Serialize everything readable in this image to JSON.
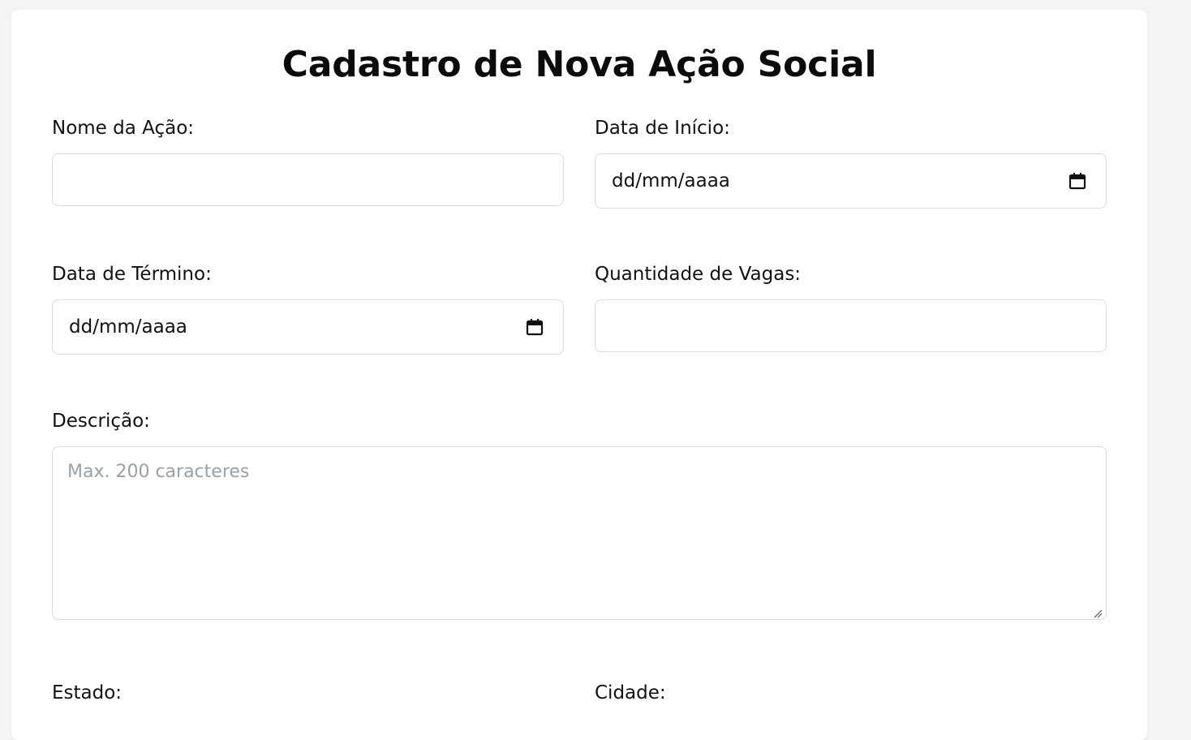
{
  "form": {
    "title": "Cadastro de Nova Ação Social",
    "fields": {
      "nome": {
        "label": "Nome da Ação:",
        "value": ""
      },
      "data_inicio": {
        "label": "Data de Início:",
        "value": "dd/mm/aaaa"
      },
      "data_termino": {
        "label": "Data de Término:",
        "value": "dd/mm/aaaa"
      },
      "vagas": {
        "label": "Quantidade de Vagas:",
        "value": ""
      },
      "descricao": {
        "label": "Descrição:",
        "placeholder": "Max. 200 caracteres"
      },
      "estado": {
        "label": "Estado:"
      },
      "cidade": {
        "label": "Cidade:"
      }
    }
  },
  "icons": {
    "calendar": "calendar-icon",
    "resize": "resize-handle-icon"
  },
  "colors": {
    "page_background": "#f3f4f6",
    "card_background": "#ffffff",
    "border": "#d8dbe0",
    "placeholder": "#9aa0a8"
  }
}
